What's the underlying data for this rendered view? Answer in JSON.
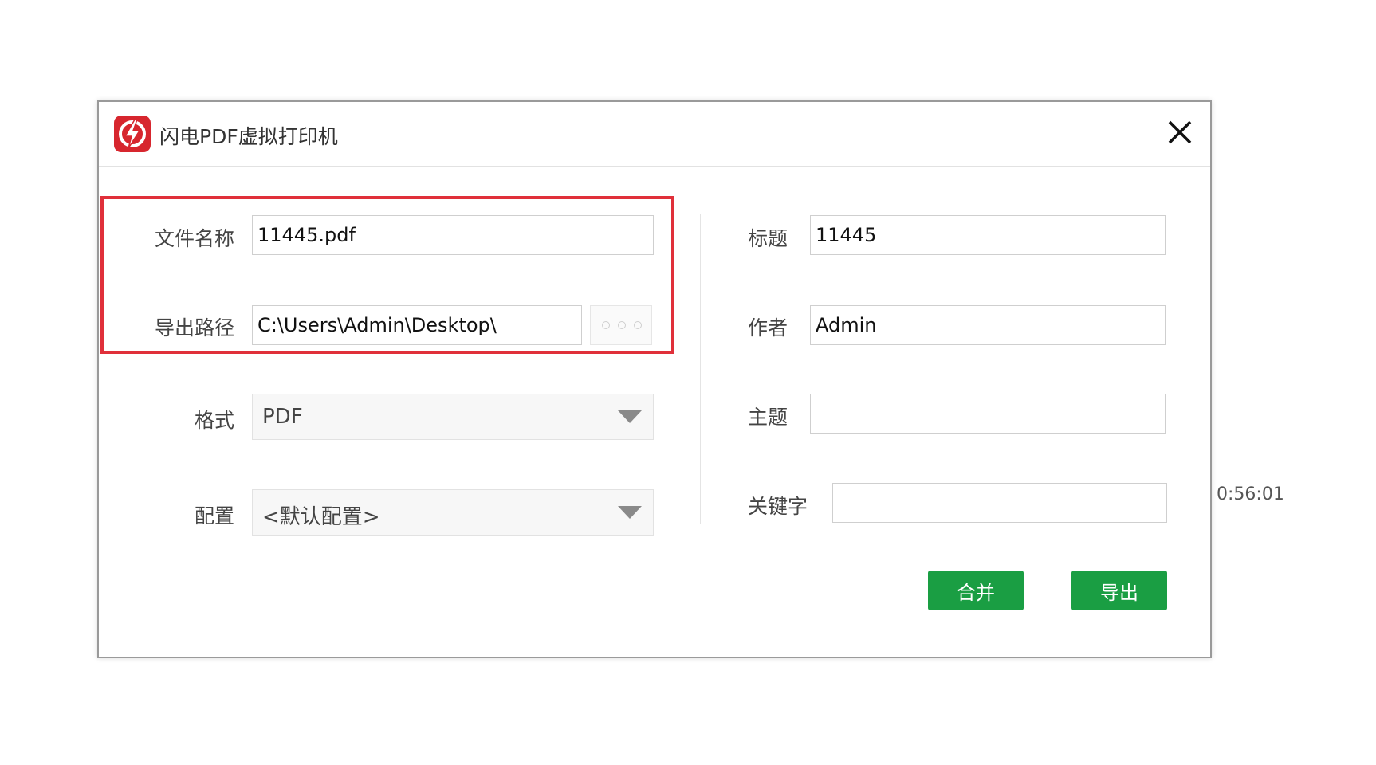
{
  "window": {
    "title": "闪电PDF虚拟打印机",
    "logo_icon": "lightning-pdf-logo-icon",
    "close_icon": "close-icon"
  },
  "left_form": {
    "file_name": {
      "label": "文件名称",
      "value": "11445.pdf"
    },
    "export_path": {
      "label": "导出路径",
      "value": "C:\\Users\\Admin\\Desktop\\",
      "browse_icon": "ellipsis-icon"
    },
    "format": {
      "label": "格式",
      "selected": "PDF"
    },
    "config": {
      "label": "配置",
      "selected": "<默认配置>"
    }
  },
  "right_form": {
    "title": {
      "label": "标题",
      "value": "11445"
    },
    "author": {
      "label": "作者",
      "value": "Admin"
    },
    "subject": {
      "label": "主题",
      "value": ""
    },
    "keywords": {
      "label": "关键字",
      "value": ""
    }
  },
  "buttons": {
    "merge": "合并",
    "export": "导出"
  },
  "background": {
    "time_text": "0:56:01"
  },
  "colors": {
    "accent_green": "#1a9e43",
    "highlight_red": "#e0303a",
    "logo_red": "#d7262e"
  }
}
